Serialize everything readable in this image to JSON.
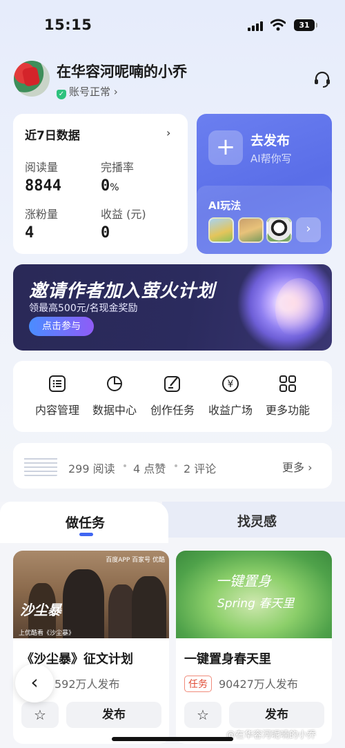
{
  "status": {
    "time": "15:15",
    "battery": "31"
  },
  "profile": {
    "name": "在华容河呢喃的小乔",
    "account_status": "账号正常 ›"
  },
  "data_card": {
    "title": "近7日数据",
    "chevron": "›",
    "items": [
      {
        "label": "阅读量",
        "value": "8844"
      },
      {
        "label": "完播率",
        "value": "0",
        "unit": "%"
      },
      {
        "label": "涨粉量",
        "value": "4"
      },
      {
        "label": "收益 (元)",
        "value": "0"
      }
    ]
  },
  "publish_card": {
    "plus": "+",
    "title": "去发布",
    "subtitle": "AI帮你写",
    "ai_title": "AI玩法",
    "ai_arrow": "›"
  },
  "banner": {
    "title": "邀请作者加入萤火计划",
    "subtitle": "领最高500元/名现金奖励",
    "button": "点击参与"
  },
  "shortcuts": [
    {
      "label": "内容管理",
      "icon": "list-icon"
    },
    {
      "label": "数据中心",
      "icon": "pie-chart-icon"
    },
    {
      "label": "创作任务",
      "icon": "edit-icon"
    },
    {
      "label": "收益广场",
      "icon": "yen-icon"
    },
    {
      "label": "更多功能",
      "icon": "grid-icon"
    }
  ],
  "stats": {
    "reads": "299 阅读",
    "likes": "4 点赞",
    "comments": "2 评论",
    "more": "更多 ›"
  },
  "tabs": [
    {
      "label": "做任务",
      "active": true
    },
    {
      "label": "找灵感",
      "active": false
    }
  ],
  "tasks": [
    {
      "title": "《沙尘暴》征文计划",
      "meta": "592万人发布",
      "poster_title": "沙尘暴",
      "poster_sub": "上优酷看《沙尘暴》",
      "poster_logos": "百度APP 百家号 优酷",
      "star": "☆",
      "publish": "发布"
    },
    {
      "title": "一键置身春天里",
      "tag": "任务",
      "meta": "90427万人发布",
      "poster_title": "一键置身",
      "poster_sub": "Spring 春天里",
      "star": "☆",
      "publish": "发布"
    }
  ],
  "back": "‹",
  "watermark": "@在华容河呢喃的小乔"
}
